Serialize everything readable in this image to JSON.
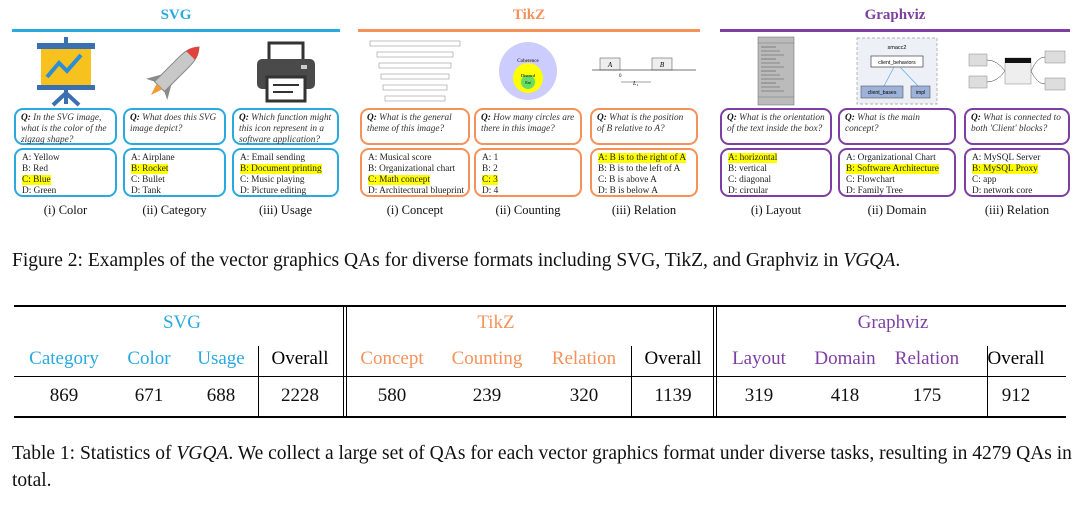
{
  "colors": {
    "svg": "#29a9e0",
    "tikz": "#f4925a",
    "graphviz": "#7e3fa2",
    "highlight": "#ffff00"
  },
  "figure": {
    "sections": [
      {
        "title": "SVG",
        "panels": [
          {
            "icon": "presentation-chart-icon",
            "question": "In the SVG image, what is the color of the zigzag shape?",
            "options": [
              "A: Yellow",
              "B: Red",
              "C: Blue",
              "D: Green"
            ],
            "answer_index": 2,
            "caption": "(i) Color"
          },
          {
            "icon": "rocket-icon",
            "question": "What does this SVG image depict?",
            "options": [
              "A: Airplane",
              "B: Rocket",
              "C: Bullet",
              "D: Tank"
            ],
            "answer_index": 1,
            "caption": "(ii) Category"
          },
          {
            "icon": "printer-icon",
            "question": "Which function might this icon represent in a software application?",
            "options": [
              "A: Email sending",
              "B: Document printing",
              "C: Music playing",
              "D: Picture editing"
            ],
            "answer_index": 1,
            "caption": "(iii) Usage"
          }
        ]
      },
      {
        "title": "TikZ",
        "panels": [
          {
            "question": "What is the general theme of this image?",
            "options": [
              "A: Musical score",
              "B: Organizational chart",
              "C: Math concept",
              "D: Architectural blueprint"
            ],
            "answer_index": 2,
            "caption": "(i) Concept"
          },
          {
            "question": "How many circles are there in this image?",
            "options": [
              "A: 1",
              "B: 2",
              "C: 3",
              "D: 4"
            ],
            "answer_index": 2,
            "caption": "(ii) Counting",
            "labels": [
              "Coherence",
              "Discord",
              "Ent"
            ]
          },
          {
            "question": "What is the position of B relative to A?",
            "options": [
              "A: B is to the right of A",
              "B: B is to the left of A",
              "C: B is above A",
              "D: B is below A"
            ],
            "answer_index": 0,
            "caption": "(iii) Relation",
            "labels": [
              "A",
              "B",
              "x",
              "0",
              "L₁"
            ]
          }
        ]
      },
      {
        "title": "Graphviz",
        "panels": [
          {
            "question": "What is the orientation of the text inside the box?",
            "options": [
              "A: horizontal",
              "B: vertical",
              "C: diagonal",
              "D: circular"
            ],
            "answer_index": 0,
            "caption": "(i) Layout"
          },
          {
            "question": "What is the main concept?",
            "options": [
              "A: Organizational Chart",
              "B: Software Architecture",
              "C: Flowchart",
              "D: Family Tree"
            ],
            "answer_index": 1,
            "caption": "(ii) Domain",
            "labels": [
              "smacc2",
              "client_behaviors",
              "client_bases",
              "impl"
            ]
          },
          {
            "question": "What is connected to both 'Client' blocks?",
            "options": [
              "A: MySQL Server",
              "B: MySQL Proxy",
              "C: app",
              "D: network core"
            ],
            "answer_index": 1,
            "caption": "(iii) Relation"
          }
        ]
      }
    ],
    "q_prefix": "Q:",
    "caption_pre": "Figure 2: Examples of the vector graphics QAs for diverse formats including SVG, TikZ, and Graphviz in ",
    "caption_em": "VGQA",
    "caption_post": "."
  },
  "table": {
    "groups": [
      "SVG",
      "TikZ",
      "Graphviz"
    ],
    "headers": [
      "Category",
      "Color",
      "Usage",
      "Overall",
      "Concept",
      "Counting",
      "Relation",
      "Overall",
      "Layout",
      "Domain",
      "Relation",
      "Overall"
    ],
    "values": [
      "869",
      "671",
      "688",
      "2228",
      "580",
      "239",
      "320",
      "1139",
      "319",
      "418",
      "175",
      "912"
    ],
    "caption_pre": "Table 1: Statistics of ",
    "caption_em": "VGQA",
    "caption_post": ". We collect a large set of QAs for each vector graphics format under diverse tasks, resulting in 4279 QAs in total."
  }
}
